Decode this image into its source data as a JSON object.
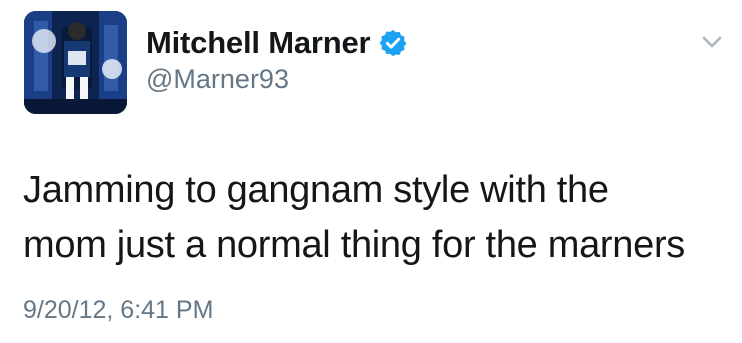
{
  "tweet": {
    "author": {
      "display_name": "Mitchell Marner",
      "handle": "@Marner93",
      "verified": true,
      "avatar_icon": "avatar-photo"
    },
    "text": "Jamming to gangnam style with the\nmom just a normal thing for the marners",
    "timestamp": "9/20/12, 6:41 PM",
    "menu_icon": "chevron-down-icon"
  },
  "colors": {
    "name": "#14171a",
    "secondary": "#657786",
    "verified_badge": "#1da1f2",
    "chevron": "#aab8c2"
  }
}
